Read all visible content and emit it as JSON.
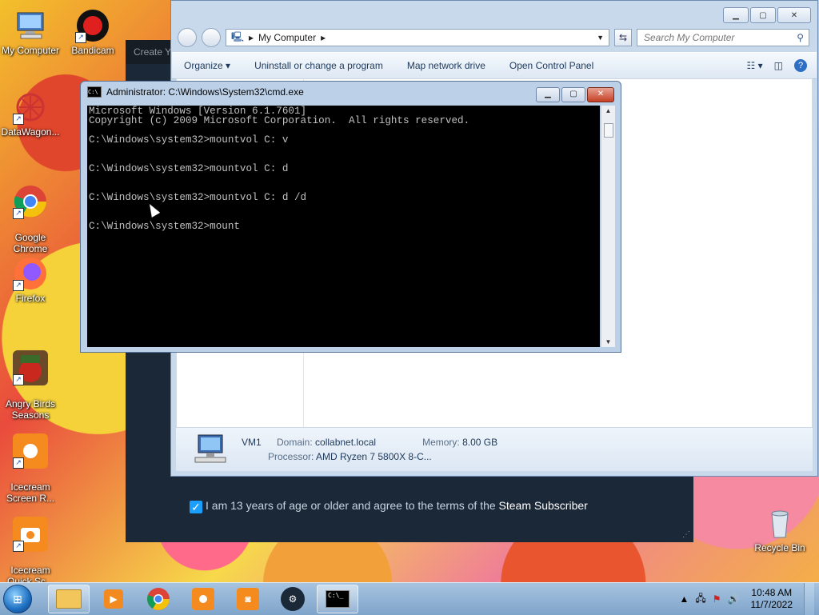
{
  "desktop_icons": [
    {
      "label": "My Computer"
    },
    {
      "label": "Bandicam"
    },
    {
      "label": "DataWagon..."
    },
    {
      "label": "Google\nChrome"
    },
    {
      "label": "Firefox"
    },
    {
      "label": "Angry Birds\nSeasons"
    },
    {
      "label": "Icecream\nScreen R..."
    },
    {
      "label": "Icecream\nQuick Sc..."
    },
    {
      "label": "Recycle Bin"
    }
  ],
  "steam_dialog": {
    "title_partial": "Create Yo",
    "agree_text": "I am 13 years of age or older and agree to the terms of the ",
    "agree_link": "Steam Subscriber"
  },
  "explorer": {
    "address_path": "My Computer",
    "search_placeholder": "Search My Computer",
    "commands": [
      "Organize",
      "Uninstall or change a program",
      "Map network drive",
      "Open Control Panel"
    ],
    "details": {
      "name": "VM1",
      "domain_label": "Domain:",
      "domain_value": "collabnet.local",
      "memory_label": "Memory:",
      "memory_value": "8.00 GB",
      "processor_label": "Processor:",
      "processor_value": "AMD Ryzen 7 5800X 8-C..."
    }
  },
  "cmd": {
    "title": "Administrator: C:\\Windows\\System32\\cmd.exe",
    "console_text": "Microsoft Windows [Version 6.1.7601]\nCopyright (c) 2009 Microsoft Corporation.  All rights reserved.\n\nC:\\Windows\\system32>mountvol C: v\n\n\nC:\\Windows\\system32>mountvol C: d\n\n\nC:\\Windows\\system32>mountvol C: d /d\n\n\nC:\\Windows\\system32>mount"
  },
  "taskbar": {
    "time": "10:48 AM",
    "date": "11/7/2022"
  }
}
